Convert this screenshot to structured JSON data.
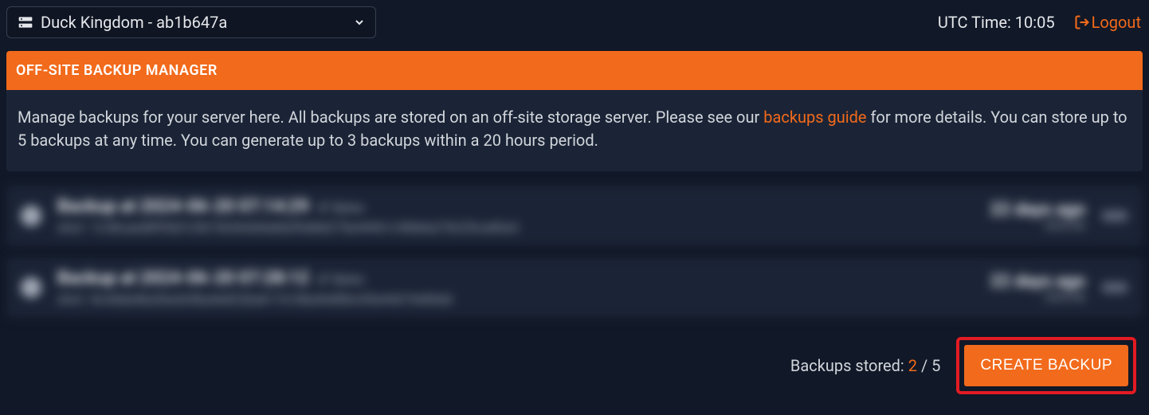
{
  "topbar": {
    "server_name": "Duck Kingdom - ab1b647a",
    "utc_label": "UTC Time: 10:05",
    "logout_label": "Logout"
  },
  "panel": {
    "title": "OFF-SITE BACKUP MANAGER",
    "desc_prefix": "Manage backups for your server here. All backups are stored on an off-site storage server. Please see our ",
    "desc_link": "backups guide",
    "desc_suffix": " for more details. You can store up to 5 backups at any time. You can generate up to 3 backups within a 20 hours period."
  },
  "backups": [
    {
      "name": "Backup at 2024-06-20 07:14:29",
      "size": "47 Bytes",
      "hash": "sha1: 7c38caed8f95d7c56736364d4a8d2f6d8d275e44961c98b8a27b225ca80a3",
      "ago": "22 days ago",
      "abs": "2024-06"
    },
    {
      "name": "Backup at 2024-06-20 07:28:12",
      "size": "47 Bytes",
      "hash": "sha1: 8c4dda4be2ba3e5ba4e822ba617e18ba9e886c05e44d19e80dd",
      "ago": "22 days ago",
      "abs": "2024-06"
    }
  ],
  "footer": {
    "stored_label": "Backups stored: ",
    "count": "2",
    "sep": " / ",
    "max": "5",
    "create_label": "CREATE BACKUP"
  }
}
